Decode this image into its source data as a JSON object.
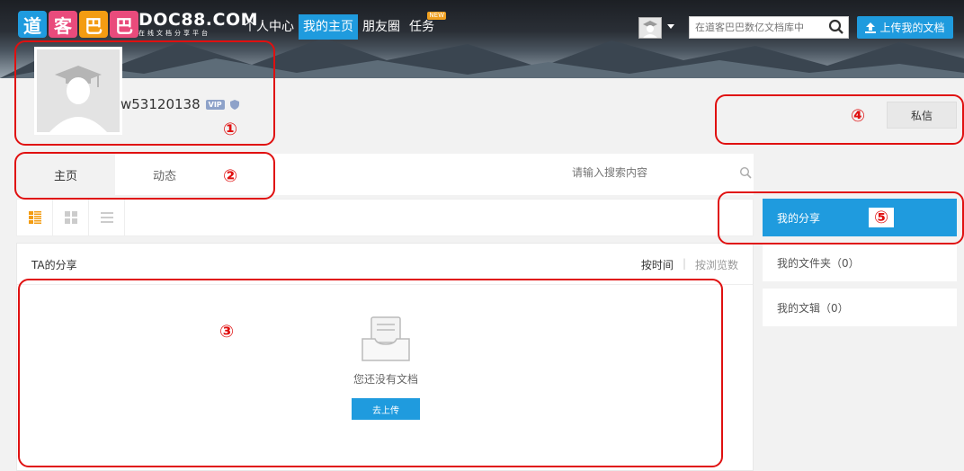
{
  "header": {
    "logo_chars": [
      "道",
      "客",
      "巴",
      "巴"
    ],
    "logo_colors": [
      "#1f9bde",
      "#e94b7c",
      "#f39c12",
      "#e94b7c"
    ],
    "site_name": "DOC88.COM",
    "site_slogan": "在线文档分享平台",
    "nav": [
      {
        "label": "个人中心",
        "active": false
      },
      {
        "label": "我的主页",
        "active": true
      },
      {
        "label": "朋友圈",
        "active": false
      },
      {
        "label": "任务",
        "active": false,
        "badge": "NEW"
      }
    ],
    "search_placeholder": "在道客巴巴数亿文档库中",
    "upload_label": "上传我的文档"
  },
  "profile": {
    "username": "w53120138",
    "vip_label": "VIP",
    "message_button": "私信"
  },
  "tabs": [
    {
      "label": "主页",
      "active": true
    },
    {
      "label": "动态",
      "active": false
    }
  ],
  "content_search_placeholder": "请输入搜索内容",
  "content": {
    "title": "TA的分享",
    "sort_by_time": "按时间",
    "sort_sep": "|",
    "sort_by_views": "按浏览数",
    "empty_text": "您还没有文档",
    "go_upload": "去上传"
  },
  "sidebar": {
    "items": [
      {
        "label": "我的分享",
        "active": true
      },
      {
        "label": "我的文件夹（0）",
        "active": false
      },
      {
        "label": "我的文辑（0）",
        "active": false
      }
    ]
  },
  "callouts": [
    "①",
    "②",
    "③",
    "④",
    "⑤"
  ],
  "colors": {
    "accent": "#1f9bde",
    "callout": "#e01010"
  }
}
